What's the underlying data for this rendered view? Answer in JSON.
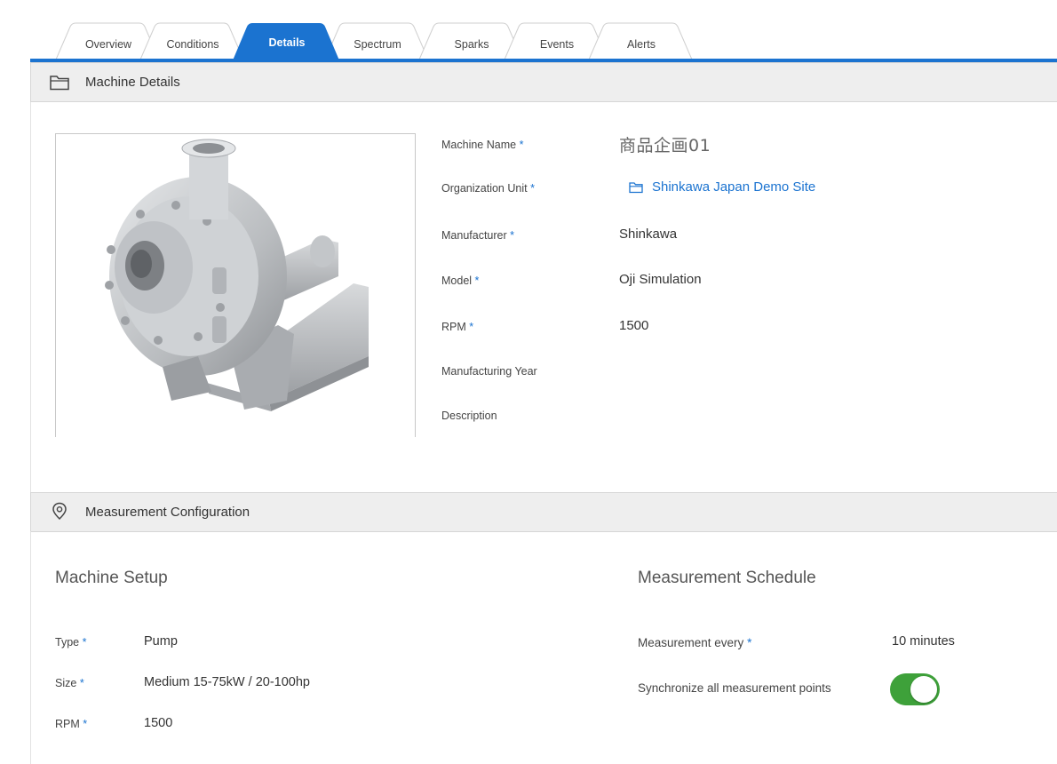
{
  "tabs": [
    {
      "label": "Overview",
      "active": false
    },
    {
      "label": "Conditions",
      "active": false
    },
    {
      "label": "Details",
      "active": true
    },
    {
      "label": "Spectrum",
      "active": false
    },
    {
      "label": "Sparks",
      "active": false
    },
    {
      "label": "Events",
      "active": false
    },
    {
      "label": "Alerts",
      "active": false
    }
  ],
  "machine_details": {
    "section_title": "Machine Details",
    "fields": {
      "machine_name": {
        "label": "Machine Name",
        "value": "商品企画01"
      },
      "organization_unit": {
        "label": "Organization Unit",
        "value": "Shinkawa Japan Demo Site"
      },
      "manufacturer": {
        "label": "Manufacturer",
        "value": "Shinkawa"
      },
      "model": {
        "label": "Model",
        "value": "Oji Simulation"
      },
      "rpm": {
        "label": "RPM",
        "value": "1500"
      },
      "manufacturing_year": {
        "label": "Manufacturing Year",
        "value": ""
      },
      "description": {
        "label": "Description",
        "value": ""
      }
    },
    "required_mark": "*"
  },
  "measurement_configuration": {
    "section_title": "Measurement Configuration",
    "machine_setup": {
      "title": "Machine Setup",
      "type": {
        "label": "Type",
        "value": "Pump"
      },
      "size": {
        "label": "Size",
        "value": "Medium 15-75kW / 20-100hp"
      },
      "rpm": {
        "label": "RPM",
        "value": "1500"
      }
    },
    "schedule": {
      "title": "Measurement Schedule",
      "every": {
        "label": "Measurement every",
        "value": "10 minutes"
      },
      "sync": {
        "label": "Synchronize all measurement points",
        "enabled": true
      }
    }
  },
  "colors": {
    "accent": "#1b73d0",
    "toggle_on": "#3ea13a",
    "section_bg": "#eeeeee"
  },
  "icons": {
    "machine_details": "folder-icon",
    "measurement_configuration": "location-pin-icon",
    "organization_unit": "folder-icon"
  }
}
